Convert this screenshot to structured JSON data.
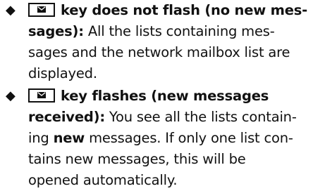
{
  "items": [
    {
      "bullet": "◆",
      "key_icon": "envelope-key-icon",
      "heading_line1": "key does not flash (no new mes-",
      "heading_line2": "sages):",
      "text_line2": " All the lists containing mes-",
      "text_line3": "sages and the network mailbox list are",
      "text_line4": "displayed."
    },
    {
      "bullet": "◆",
      "key_icon": "envelope-key-icon",
      "heading_line1": "key flashes (new messages",
      "heading_line2": "received):",
      "text_line2": " You see all the lists contain-",
      "text_line3_a": "ing ",
      "text_line3_bold": "new",
      "text_line3_b": " messages. If only one list con-",
      "text_line4": "tains new messages, this will be",
      "text_line5": "opened automatically."
    }
  ]
}
